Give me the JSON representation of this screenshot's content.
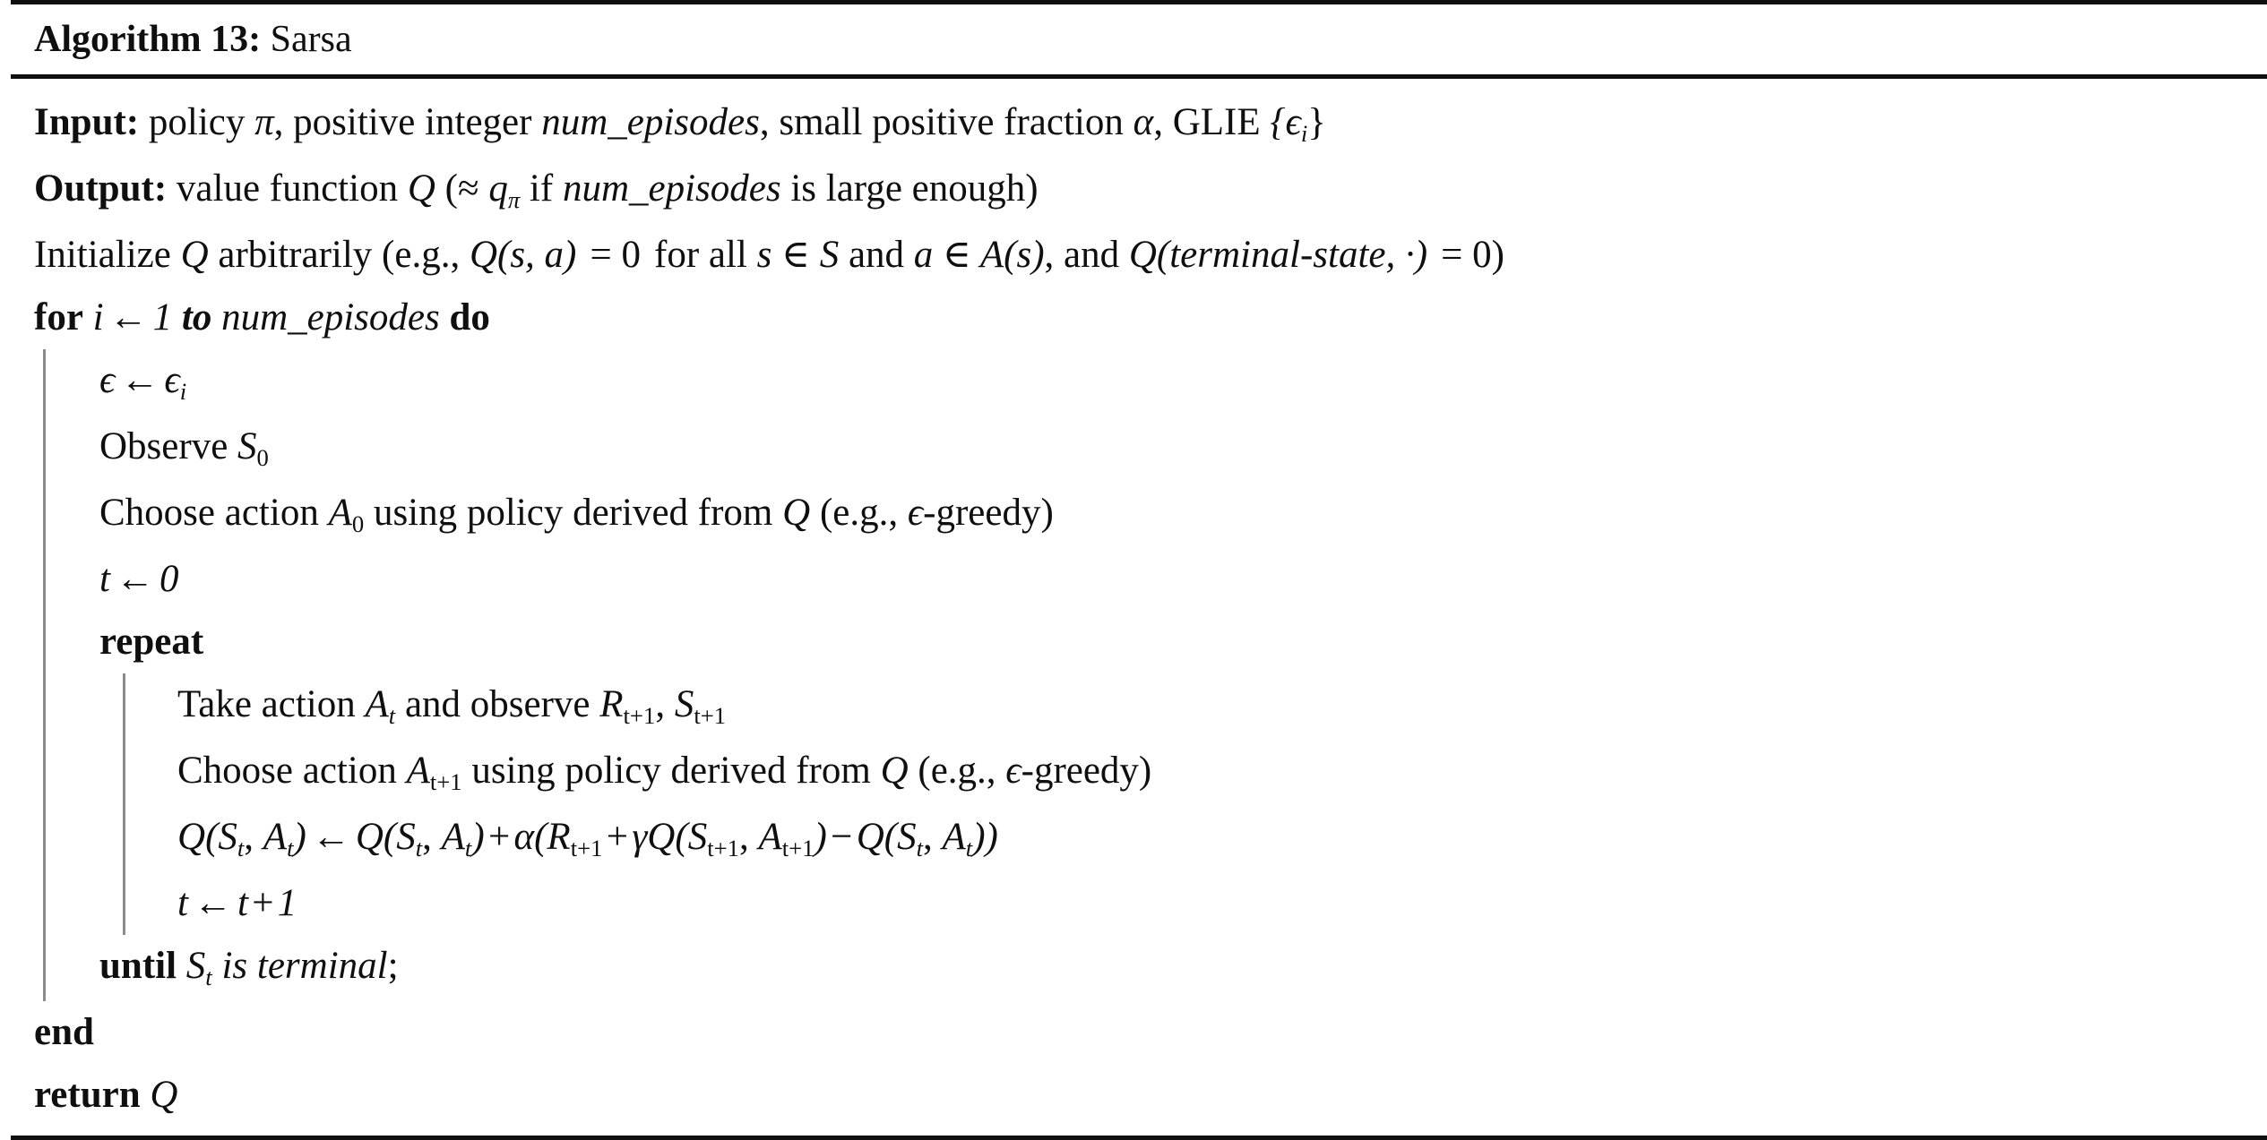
{
  "caption": {
    "label": "Algorithm 13:",
    "name": "Sarsa"
  },
  "lines": {
    "input": {
      "keyword": "Input:",
      "text_1": " policy ",
      "var_pi": "π",
      "text_2": ", positive integer ",
      "var_num_episodes": "num_episodes",
      "text_3": ", small positive fraction ",
      "var_alpha": "α",
      "text_4": ", GLIE ",
      "glie_set": "{ϵ",
      "glie_sub": "i",
      "glie_close": "}"
    },
    "output": {
      "keyword": "Output:",
      "text_1": " value function ",
      "var_q": "Q",
      "text_2": " (≈ ",
      "var_qpi": "q",
      "qpi_sub": "π",
      "text_3": " if ",
      "var_num_episodes": "num_episodes",
      "text_4": " is large enough)"
    },
    "initialize": {
      "text_1": "Initialize ",
      "var_q": "Q",
      "text_2": " arbitrarily (e.g., ",
      "q_call": "Q(s, a)",
      "eq_zero": " = 0",
      "text_3": " for all ",
      "s_in": "s ∈ ",
      "cal_s": "S",
      "text_4": " and ",
      "a_in": "a ∈ ",
      "cal_a": "A",
      "cal_a_arg": "(s)",
      "text_5": ", and ",
      "q_terminal": "Q(terminal-state, ·)",
      "eq_zero_2": " = 0)"
    },
    "for_loop": {
      "kw_for": "for",
      "var_i": "i",
      "arrow": "←",
      "start": "1",
      "kw_to": "to",
      "var_num_episodes": "num_episodes",
      "kw_do": "do"
    },
    "eps_assign": {
      "eps": "ϵ",
      "arrow": "←",
      "eps_i": "ϵ",
      "eps_i_sub": "i"
    },
    "observe_s0": {
      "text": "Observe ",
      "var_s": "S",
      "sub": "0"
    },
    "choose_a0": {
      "text_1": "Choose action ",
      "var_a": "A",
      "sub": "0",
      "text_2": " using policy derived from ",
      "var_q": "Q",
      "text_3": " (e.g., ",
      "eps": "ϵ",
      "text_4": "-greedy)"
    },
    "t_assign": {
      "var_t": "t",
      "arrow": "←",
      "value": "0"
    },
    "repeat": {
      "kw": "repeat"
    },
    "take_action": {
      "text_1": "Take action ",
      "var_a": "A",
      "a_sub": "t",
      "text_2": " and observe ",
      "var_r": "R",
      "r_sub": "t+1",
      "comma": ", ",
      "var_s": "S",
      "s_sub": "t+1"
    },
    "choose_at1": {
      "text_1": "Choose action ",
      "var_a": "A",
      "a_sub": "t+1",
      "text_2": " using policy derived from ",
      "var_q": "Q",
      "text_3": " (e.g., ",
      "eps": "ϵ",
      "text_4": "-greedy)"
    },
    "q_update": {
      "lhs_q": "Q",
      "lhs_open": "(",
      "lhs_s": "S",
      "lhs_s_sub": "t",
      "lhs_comma": ", ",
      "lhs_a": "A",
      "lhs_a_sub": "t",
      "lhs_close": ")",
      "arrow": "←",
      "rhs1_q": "Q",
      "rhs1_s": "S",
      "rhs1_s_sub": "t",
      "rhs1_a": "A",
      "rhs1_a_sub": "t",
      "plus": "+",
      "alpha": "α",
      "paren_open": "(",
      "reward": "R",
      "reward_sub": "t+1",
      "plus2": "+",
      "gamma": "γ",
      "q_next": "Q",
      "next_s": "S",
      "next_s_sub": "t+1",
      "next_a": "A",
      "next_a_sub": "t+1",
      "minus": "−",
      "q_last": "Q",
      "last_s": "S",
      "last_s_sub": "t",
      "last_a": "A",
      "last_a_sub": "t",
      "paren_close": "))"
    },
    "t_increment": {
      "var_t": "t",
      "arrow": "←",
      "rhs_t": "t",
      "plus": "+",
      "one": "1"
    },
    "until": {
      "kw": "until",
      "var_s": "S",
      "s_sub": "t",
      "text": "is terminal",
      "semicolon": ";"
    },
    "end": {
      "kw": "end"
    },
    "return": {
      "kw": "return",
      "var_q": "Q"
    }
  }
}
